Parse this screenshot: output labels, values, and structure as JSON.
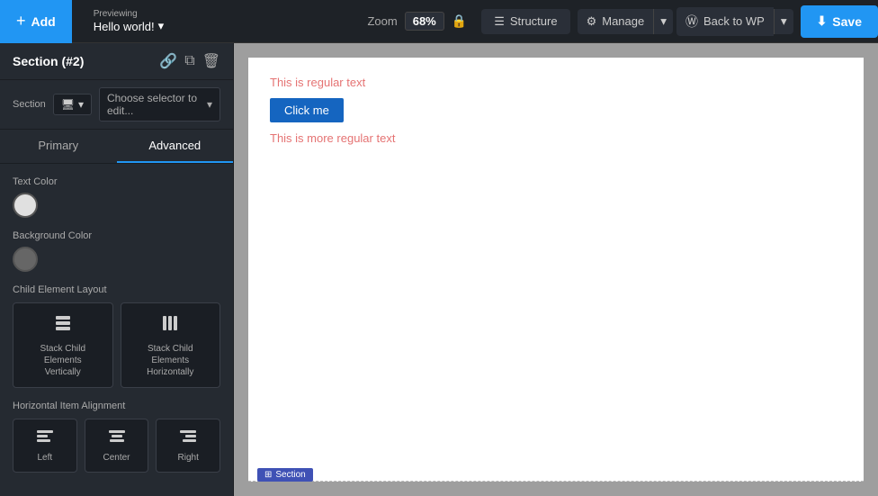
{
  "topbar": {
    "add_label": "Add",
    "previewing_label": "Previewing",
    "preview_value": "Hello world!",
    "zoom_label": "Zoom",
    "zoom_value": "68%",
    "structure_label": "Structure",
    "manage_label": "Manage",
    "back_to_wp_label": "Back to WP",
    "save_label": "Save"
  },
  "left_panel": {
    "section_title": "Section (#2)",
    "section_label": "Section",
    "selector_placeholder": "Choose selector to edit...",
    "tab_primary": "Primary",
    "tab_advanced": "Advanced",
    "text_color_label": "Text Color",
    "bg_color_label": "Background Color",
    "child_layout_label": "Child Element Layout",
    "layout_options": [
      {
        "label": "Stack Child Elements\nVertically"
      },
      {
        "label": "Stack Child Elements\nHorizontally"
      }
    ],
    "h_align_label": "Horizontal Item Alignment",
    "align_options": [
      {
        "label": "Left"
      },
      {
        "label": "Center"
      },
      {
        "label": "Right"
      }
    ]
  },
  "canvas": {
    "regular_text": "This is regular text",
    "button_label": "Click me",
    "more_text": "This is more regular text",
    "section_badge": "Section"
  }
}
